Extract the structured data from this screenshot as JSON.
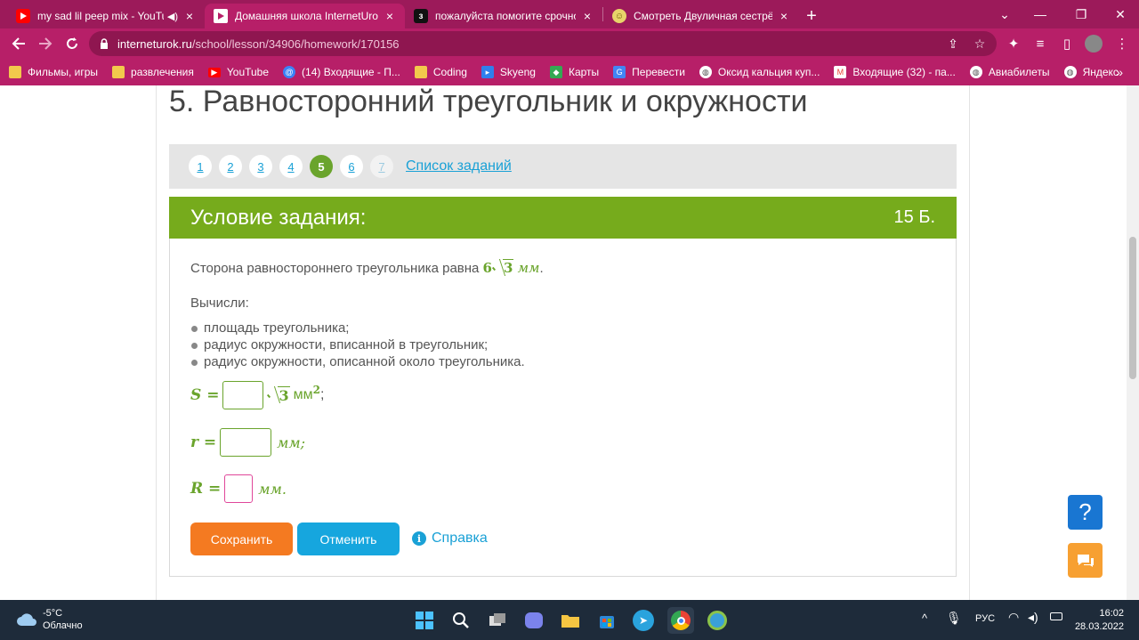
{
  "browser": {
    "tabs": [
      {
        "title": "my sad lil peep mix - YouTub",
        "icon": "youtube-icon",
        "color": "#ff0000",
        "glyph": "▶",
        "active": false,
        "speaker": true
      },
      {
        "title": "Домашняя школа InternetUrok.r",
        "icon": "interneturok-icon",
        "color": "#ffffff",
        "glyph": "▶",
        "active": true
      },
      {
        "title": "пожалуйста помогите срочно -",
        "icon": "znanija-icon",
        "color": "#111111",
        "glyph": "з",
        "active": false
      },
      {
        "title": "Смотреть Двуличная сестрёнка",
        "icon": "anime-site-icon",
        "color": "#e8d46a",
        "glyph": "☺",
        "active": false
      }
    ],
    "close_glyph": "×",
    "new_tab_glyph": "+",
    "url_host": "interneturok.ru",
    "url_path": "/school/lesson/34906/homework/170156",
    "bookmarks": [
      {
        "label": "Фильмы, игры",
        "icon": "folder-icon",
        "color": "#f2c94c"
      },
      {
        "label": "развлечения",
        "icon": "folder-icon",
        "color": "#f2c94c"
      },
      {
        "label": "YouTube",
        "icon": "youtube-icon",
        "color": "#ff0000"
      },
      {
        "label": "(14) Входящие - П...",
        "icon": "mail-icon",
        "color": "#3b82f6"
      },
      {
        "label": "Coding",
        "icon": "folder-icon",
        "color": "#f2c94c"
      },
      {
        "label": "Skyeng",
        "icon": "skyeng-icon",
        "color": "#2f80ed"
      },
      {
        "label": "Карты",
        "icon": "maps-icon",
        "color": "#34a853"
      },
      {
        "label": "Перевести",
        "icon": "translate-icon",
        "color": "#4285f4"
      },
      {
        "label": "Оксид кальция куп...",
        "icon": "globe-icon",
        "color": "#888888"
      },
      {
        "label": "Входящие (32) - па...",
        "icon": "gmail-icon",
        "color": "#ea4335"
      },
      {
        "label": "Авиабилеты",
        "icon": "globe-icon",
        "color": "#888888"
      },
      {
        "label": "Яндекс",
        "icon": "globe-icon",
        "color": "#888888"
      }
    ],
    "more_glyph": "»",
    "accent": "#b71f68"
  },
  "page": {
    "lesson_title": "5. Равносторонний треугольник и окружности",
    "task_numbers": [
      "1",
      "2",
      "3",
      "4",
      "5",
      "6",
      "7"
    ],
    "active_task": "5",
    "task_list_link": "Список заданий",
    "condition_heading": "Условие задания:",
    "points": "15 Б.",
    "statement_prefix": "Сторона равностороннего треугольника равна ",
    "side_coeff": "6",
    "side_radicand": "3",
    "side_unit": "мм",
    "statement_suffix": ".",
    "compute_label": "Вычисли:",
    "items": [
      "площадь треугольника;",
      "радиус окружности, вписанной в треугольник;",
      "радиус окружности, описанной около треугольника."
    ],
    "s_label": "S =",
    "s_radicand": "3",
    "s_unit": "мм",
    "s_exp": "2",
    "s_end": ";",
    "r_label": "r =",
    "r_unit": "мм;",
    "R_label": "R =",
    "R_unit": "мм.",
    "save_button": "Сохранить",
    "cancel_button": "Отменить",
    "help_link": "Справка",
    "help_glyph": "i",
    "question_glyph": "?",
    "green": "#76ab1c",
    "orange": "#f47a21",
    "blue": "#16a6de"
  },
  "taskbar": {
    "temperature": "-5°C",
    "weather": "Облачно",
    "language": "РУС",
    "time": "16:02",
    "date": "28.03.2022"
  }
}
